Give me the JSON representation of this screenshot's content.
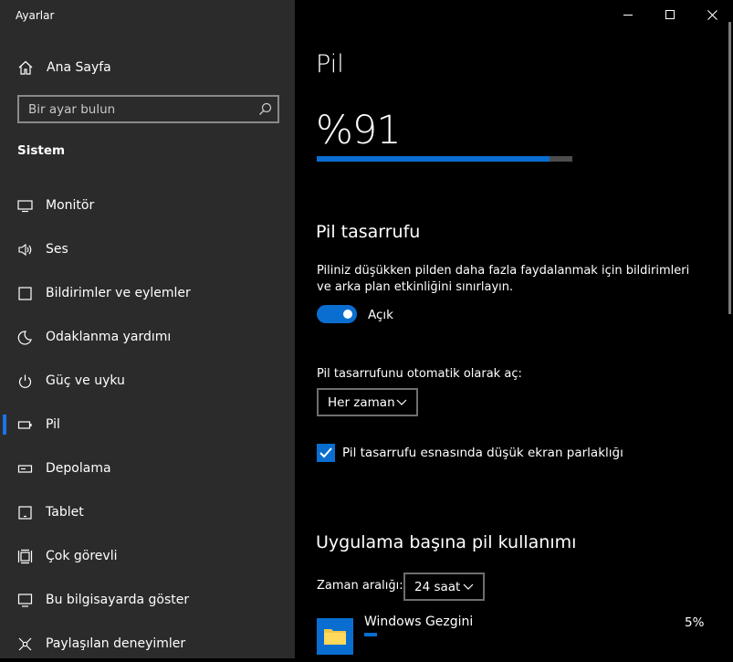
{
  "window": {
    "title": "Ayarlar"
  },
  "sidebar": {
    "home_label": "Ana Sayfa",
    "search_placeholder": "Bir ayar bulun",
    "section_title": "Sistem",
    "items": [
      {
        "label": "Monitör",
        "icon": "monitor-icon"
      },
      {
        "label": "Ses",
        "icon": "speaker-icon"
      },
      {
        "label": "Bildirimler ve eylemler",
        "icon": "notification-icon"
      },
      {
        "label": "Odaklanma yardımı",
        "icon": "moon-icon"
      },
      {
        "label": "Güç ve uyku",
        "icon": "power-icon"
      },
      {
        "label": "Pil",
        "icon": "battery-icon",
        "active": true
      },
      {
        "label": "Depolama",
        "icon": "storage-icon"
      },
      {
        "label": "Tablet",
        "icon": "tablet-icon"
      },
      {
        "label": "Çok görevli",
        "icon": "multitask-icon"
      },
      {
        "label": "Bu bilgisayarda göster",
        "icon": "project-icon"
      },
      {
        "label": "Paylaşılan deneyimler",
        "icon": "share-icon"
      }
    ]
  },
  "main": {
    "title": "Pil",
    "battery_percent_text": "%91",
    "battery_level": 0.91,
    "saver": {
      "heading": "Pil tasarrufu",
      "description": "Piliniz düşükken pilden daha fazla faydalanmak için bildirimleri ve arka plan etkinliğini sınırlayın.",
      "toggle_state": "Açık",
      "auto_label": "Pil tasarrufunu otomatik olarak aç:",
      "auto_value": "Her zaman",
      "brightness_label": "Pil tasarrufu esnasında düşük ekran parlaklığı",
      "brightness_checked": true
    },
    "usage": {
      "heading": "Uygulama başına pil kullanımı",
      "range_label": "Zaman aralığı:",
      "range_value": "24 saat",
      "apps": [
        {
          "name": "Windows Gezgini",
          "percent": "5%",
          "icon": "folder-icon"
        }
      ]
    }
  },
  "colors": {
    "accent": "#0a6ed1",
    "sidebar_bg": "#2b2b2b",
    "main_bg": "#000000"
  }
}
